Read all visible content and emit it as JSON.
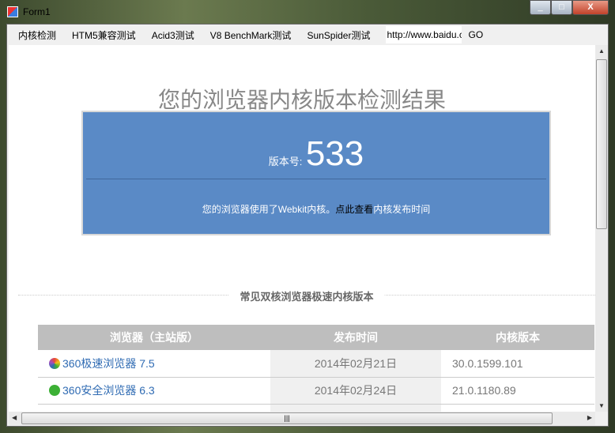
{
  "window": {
    "title": "Form1",
    "minimize": "_",
    "maximize": "□",
    "close": "X"
  },
  "toolbar": {
    "items": [
      "内核检测",
      "HTM5兼容测试",
      "Acid3测试",
      "V8 BenchMark测试",
      "SunSpider测试"
    ],
    "url": "http://www.baidu.com",
    "go": "GO"
  },
  "page": {
    "heading": "您的浏览器内核版本检测结果",
    "version_label": "版本号:",
    "version": "533",
    "desc_pre": "您的浏览器使用了Webkit内核。",
    "desc_link": "点此查看",
    "desc_post": "内核发布时间",
    "section_title": "常见双核浏览器极速内核版本",
    "table": {
      "headers": [
        "浏览器（主站版）",
        "发布时间",
        "内核版本"
      ],
      "rows": [
        {
          "browser": "360极速浏览器 7.5",
          "date": "2014年02月21日",
          "version": "30.0.1599.101",
          "icon_color": "#e8463a"
        },
        {
          "browser": "360安全浏览器 6.3",
          "date": "2014年02月24日",
          "version": "21.0.1180.89",
          "icon_color": "#3cb035"
        }
      ]
    }
  },
  "colors": {
    "box": "#5a8ac6",
    "header": "#bebebe",
    "link": "#2f6bb3"
  }
}
